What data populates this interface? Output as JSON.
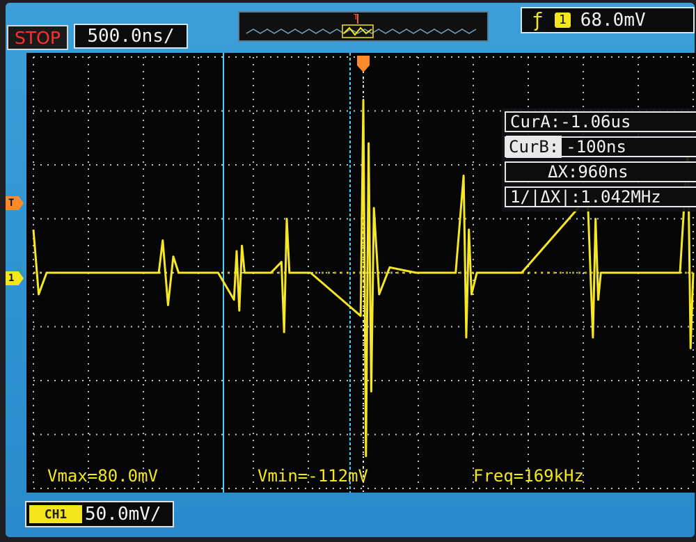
{
  "header": {
    "run_state": "STOP",
    "timebase": "500.0ns/",
    "trigger_edge_icon": "rising-edge-icon",
    "trigger_channel": "1",
    "trigger_level": "68.0mV"
  },
  "cursors": {
    "cur_a": "CurA:-1.06us",
    "cur_b_label": "CurB:",
    "cur_b_value": "-100ns",
    "delta_x": "ΔX:960ns",
    "inv_delta_x": "1/|ΔX|:1.042MHz"
  },
  "measurements": {
    "vmax": "Vmax=80.0mV",
    "vmin": "Vmin=-112mV",
    "freq": "Freq=169kHz"
  },
  "channel": {
    "badge": "CH1",
    "scale": "50.0mV/"
  },
  "markers": {
    "trigger_level_marker": "T",
    "channel_ground_marker": "1"
  },
  "colors": {
    "trace": "#f5e626",
    "cursor": "#4fd0ff",
    "trigger": "#ff8a2a",
    "frame": "#2f93d2"
  },
  "chart_data": {
    "type": "line",
    "xlabel": "",
    "ylabel": "",
    "x_unit": "us",
    "y_unit": "mV",
    "xlim": [
      -2.5,
      2.5
    ],
    "ylim": [
      -200,
      200
    ],
    "grid": true,
    "series": [
      {
        "x": [
          -2.5,
          -2.46,
          -2.4,
          -2.05,
          -1.55,
          -1.52,
          -1.48,
          -1.44,
          -1.4,
          -1.1,
          -0.98,
          -0.96,
          -0.94,
          -0.92,
          -0.9,
          -0.7,
          -0.62,
          -0.6,
          -0.58,
          -0.56,
          -0.4,
          -0.02,
          0.0,
          0.02,
          0.04,
          0.06,
          0.08,
          0.12,
          0.2,
          0.4,
          0.7,
          0.76,
          0.78,
          0.8,
          0.82,
          0.86,
          1.2,
          1.7,
          1.74,
          1.76,
          1.78,
          1.8,
          1.84,
          2.1,
          2.4,
          2.46,
          2.48,
          2.5
        ],
        "y": [
          40,
          -20,
          0,
          0,
          0,
          30,
          -30,
          15,
          0,
          0,
          -25,
          20,
          -35,
          25,
          0,
          0,
          10,
          -55,
          50,
          0,
          0,
          -40,
          160,
          -170,
          120,
          -110,
          60,
          -20,
          5,
          0,
          0,
          90,
          -60,
          40,
          -20,
          0,
          0,
          70,
          -60,
          50,
          -25,
          0,
          0,
          0,
          0,
          120,
          -70,
          0
        ]
      }
    ]
  }
}
